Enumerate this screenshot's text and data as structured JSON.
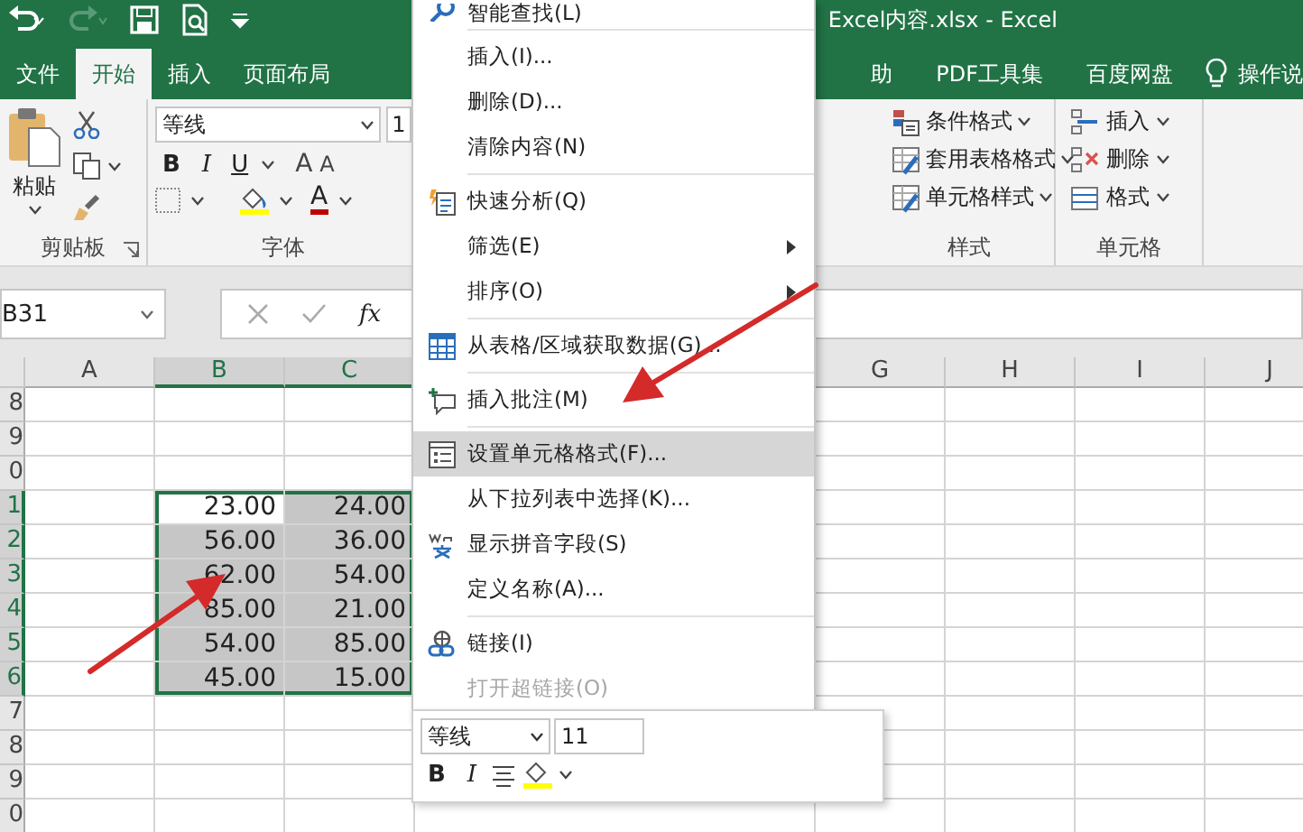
{
  "window": {
    "title": "Excel内容.xlsx  -  Excel"
  },
  "tabs": [
    {
      "label": "文件",
      "selected": false
    },
    {
      "label": "开始",
      "selected": true
    },
    {
      "label": "插入",
      "selected": false
    },
    {
      "label": "页面布局",
      "selected": false
    },
    {
      "label": "助",
      "selected": false
    },
    {
      "label": "PDF工具集",
      "selected": false
    },
    {
      "label": "百度网盘",
      "selected": false
    }
  ],
  "tell_me": "操作说",
  "clipboard": {
    "paste": "粘贴",
    "label": "剪贴板"
  },
  "font": {
    "font_name": "等线",
    "font_size": "1",
    "bold": "B",
    "italic": "I",
    "underline": "U",
    "grow": "A",
    "shrink": "A",
    "font_color_label": "A",
    "label": "字体"
  },
  "styles": {
    "items": [
      "条件格式",
      "套用表格格式",
      "单元格样式"
    ],
    "label": "样式"
  },
  "cells_group": {
    "items": [
      "插入",
      "删除",
      "格式"
    ],
    "label": "单元格"
  },
  "formula_bar": {
    "name_box": "B31",
    "fx": "fx"
  },
  "columns": [
    {
      "label": "A",
      "selected": false
    },
    {
      "label": "B",
      "selected": true
    },
    {
      "label": "C",
      "selected": true
    },
    {
      "label": "G",
      "selected": false
    },
    {
      "label": "H",
      "selected": false
    },
    {
      "label": "I",
      "selected": false
    },
    {
      "label": "J",
      "selected": false
    }
  ],
  "rows": [
    {
      "label": "8",
      "selected": false
    },
    {
      "label": "9",
      "selected": false
    },
    {
      "label": "0",
      "selected": false
    },
    {
      "label": "1",
      "selected": true,
      "cells": [
        {
          "value": "23.00",
          "active": true
        },
        {
          "value": "24.00",
          "active": false
        }
      ]
    },
    {
      "label": "2",
      "selected": true,
      "cells": [
        {
          "value": "56.00",
          "active": false
        },
        {
          "value": "36.00",
          "active": false
        }
      ]
    },
    {
      "label": "3",
      "selected": true,
      "cells": [
        {
          "value": "62.00",
          "active": false
        },
        {
          "value": "54.00",
          "active": false
        }
      ]
    },
    {
      "label": "4",
      "selected": true,
      "cells": [
        {
          "value": "85.00",
          "active": false
        },
        {
          "value": "21.00",
          "active": false
        }
      ]
    },
    {
      "label": "5",
      "selected": true,
      "cells": [
        {
          "value": "54.00",
          "active": false
        },
        {
          "value": "85.00",
          "active": false
        }
      ]
    },
    {
      "label": "6",
      "selected": true,
      "cells": [
        {
          "value": "45.00",
          "active": false
        },
        {
          "value": "15.00",
          "active": false
        }
      ]
    },
    {
      "label": "7",
      "selected": false
    },
    {
      "label": "8",
      "selected": false
    },
    {
      "label": "9",
      "selected": false
    },
    {
      "label": "0",
      "selected": false
    }
  ],
  "context_menu": [
    {
      "label": "智能查找(L)",
      "kind": "item",
      "highlighted": false,
      "disabled": false,
      "separator_before": false
    },
    {
      "label": "插入(I)...",
      "kind": "item",
      "highlighted": false,
      "disabled": false,
      "separator_before": true
    },
    {
      "label": "删除(D)...",
      "kind": "item",
      "highlighted": false,
      "disabled": false,
      "separator_before": false
    },
    {
      "label": "清除内容(N)",
      "kind": "item",
      "highlighted": false,
      "disabled": false,
      "separator_before": false
    },
    {
      "label": "快速分析(Q)",
      "kind": "item",
      "highlighted": false,
      "disabled": false,
      "separator_before": true
    },
    {
      "label": "筛选(E)",
      "kind": "submenu",
      "highlighted": false,
      "disabled": false,
      "separator_before": false
    },
    {
      "label": "排序(O)",
      "kind": "submenu",
      "highlighted": false,
      "disabled": false,
      "separator_before": false
    },
    {
      "label": "从表格/区域获取数据(G)...",
      "kind": "item",
      "highlighted": false,
      "disabled": false,
      "separator_before": true
    },
    {
      "label": "插入批注(M)",
      "kind": "item",
      "highlighted": false,
      "disabled": false,
      "separator_before": true
    },
    {
      "label": "设置单元格格式(F)...",
      "kind": "item",
      "highlighted": true,
      "disabled": false,
      "separator_before": true
    },
    {
      "label": "从下拉列表中选择(K)...",
      "kind": "item",
      "highlighted": false,
      "disabled": false,
      "separator_before": false
    },
    {
      "label": "显示拼音字段(S)",
      "kind": "item",
      "highlighted": false,
      "disabled": false,
      "separator_before": false
    },
    {
      "label": "定义名称(A)...",
      "kind": "item",
      "highlighted": false,
      "disabled": false,
      "separator_before": false
    },
    {
      "label": "链接(I)",
      "kind": "item",
      "highlighted": false,
      "disabled": false,
      "separator_before": true
    },
    {
      "label": "打开超链接(O)",
      "kind": "item",
      "highlighted": false,
      "disabled": true,
      "separator_before": false
    }
  ],
  "mini_toolbar": {
    "font_name": "等线",
    "font_size": "11",
    "bold": "B",
    "italic": "I"
  }
}
